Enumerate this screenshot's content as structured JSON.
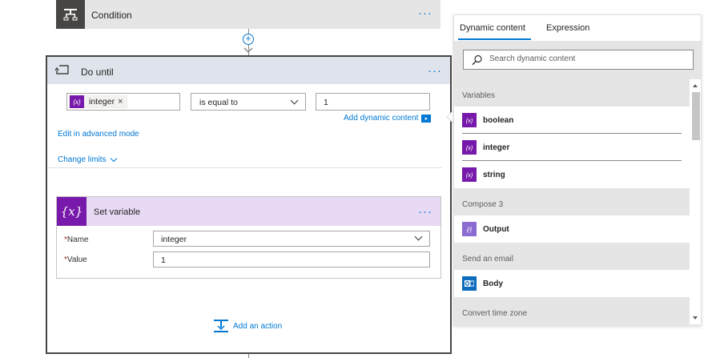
{
  "condition": {
    "title": "Condition"
  },
  "do_until": {
    "title": "Do until",
    "token_label": "integer",
    "operator": "is equal to",
    "value": "1",
    "add_dynamic_label": "Add dynamic content",
    "edit_advanced_label": "Edit in advanced mode",
    "change_limits_label": "Change limits"
  },
  "set_variable": {
    "title": "Set variable",
    "name_label": "Name",
    "name_value": "integer",
    "value_label": "Value",
    "value_value": "1"
  },
  "add_action_label": "Add an action",
  "panel": {
    "tabs": [
      "Dynamic content",
      "Expression"
    ],
    "active_tab": "Dynamic content",
    "search_placeholder": "Search dynamic content",
    "groups": [
      {
        "header": "Variables",
        "items": [
          {
            "label": "boolean",
            "icon": "variable-icon",
            "color": "#7719aa"
          },
          {
            "label": "integer",
            "icon": "variable-icon",
            "color": "#7719aa"
          },
          {
            "label": "string",
            "icon": "variable-icon",
            "color": "#7719aa"
          }
        ]
      },
      {
        "header": "Compose 3",
        "items": [
          {
            "label": "Output",
            "icon": "compose-icon",
            "color": "#8c6cd1"
          }
        ]
      },
      {
        "header": "Send an email",
        "items": [
          {
            "label": "Body",
            "icon": "outlook-icon",
            "color": "#0f6cbd"
          }
        ]
      },
      {
        "header": "Convert time zone",
        "items": []
      }
    ]
  },
  "colors": {
    "accent": "#0078d4",
    "variable": "#7719aa",
    "set_variable_header": "#e8d9f4",
    "do_until_header": "#dfe3eb",
    "condition_icon_bg": "#484644"
  }
}
